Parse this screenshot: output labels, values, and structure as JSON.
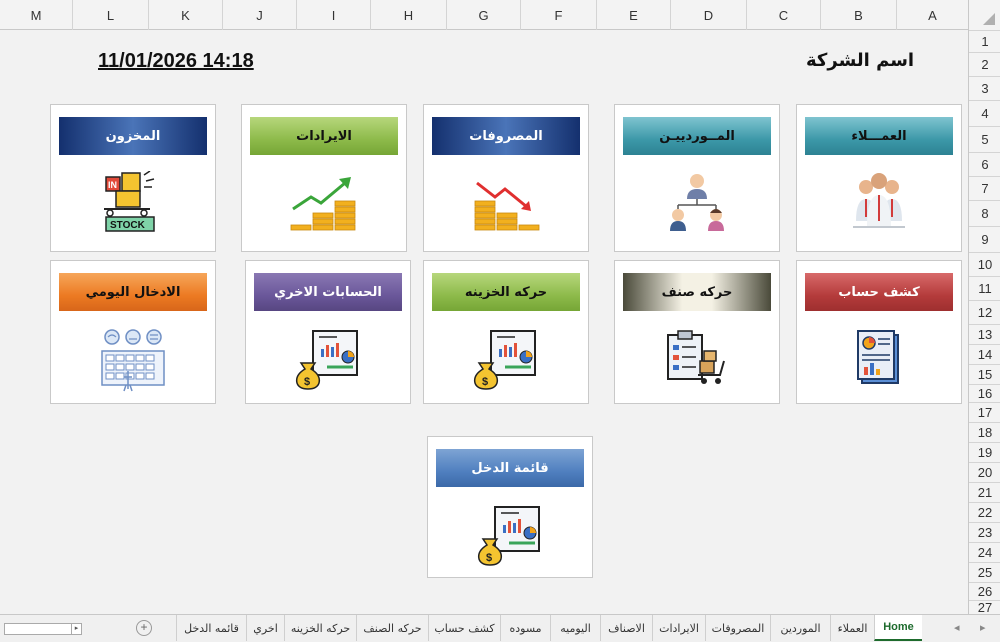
{
  "company_name": "اسم الشركة",
  "datetime": "11/01/2026 14:18",
  "columns": [
    "A",
    "B",
    "C",
    "D",
    "E",
    "F",
    "G",
    "H",
    "I",
    "J",
    "K",
    "L",
    "M"
  ],
  "rows": [
    "1",
    "2",
    "3",
    "4",
    "5",
    "6",
    "7",
    "8",
    "9",
    "10",
    "11",
    "12",
    "13",
    "14",
    "15",
    "16",
    "17",
    "18",
    "19",
    "20",
    "21",
    "22",
    "23",
    "24",
    "25",
    "26",
    "27"
  ],
  "cards": {
    "customers": "العمـــلاء",
    "suppliers": "المــوردييـن",
    "expenses": "المصروفات",
    "revenues": "الايرادات",
    "inventory": "المخزون",
    "account_statement": "كشف حساب",
    "item_movement": "حركه صنف",
    "treasury_movement": "حركه الخزينه",
    "other_accounts": "الحسابات الاخري",
    "daily_entry": "الادخال اليومي",
    "income_statement": "قائمة الدخل"
  },
  "icons": {
    "customers": "group-people-icon",
    "suppliers": "org-chart-people-icon",
    "expenses": "coins-down-arrow-icon",
    "revenues": "coins-up-arrow-icon",
    "inventory": "stock-cart-icon",
    "account_statement": "report-document-icon",
    "item_movement": "clipboard-hand-truck-icon",
    "treasury_movement": "money-bag-chart-icon",
    "other_accounts": "money-bag-chart-icon",
    "daily_entry": "data-entry-keyboard-icon",
    "income_statement": "money-bag-chart-icon",
    "stock_label": "STOCK",
    "stock_in": "IN"
  },
  "tabs": [
    "Home",
    "العملاء",
    "الموردين",
    "المصروفات",
    "الايرادات",
    "الاصناف",
    "اليوميه",
    "مسوده",
    "كشف حساب",
    "حركه الصنف",
    "حركه الخزينه",
    "اخري",
    "قائمه الدخل"
  ],
  "active_tab": "Home"
}
